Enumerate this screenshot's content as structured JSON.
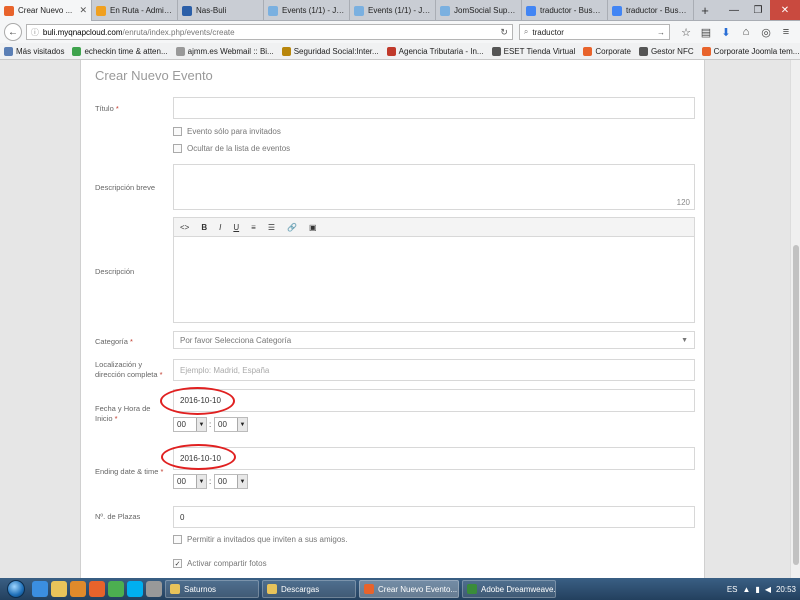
{
  "tabs": [
    {
      "label": "Crear Nuevo ...",
      "color": "#e8632b",
      "active": true
    },
    {
      "label": "En Ruta - Admin...",
      "color": "#f0a020",
      "active": false
    },
    {
      "label": "Nas-Buli",
      "color": "#2b5fa8",
      "active": false
    },
    {
      "label": "Events (1/1) - Jo...",
      "color": "#7ab0e0",
      "active": false
    },
    {
      "label": "Events (1/1) - Jo...",
      "color": "#7ab0e0",
      "active": false
    },
    {
      "label": "JomSocial Supp...",
      "color": "#7ab0e0",
      "active": false
    },
    {
      "label": "traductor - Busc...",
      "color": "#4285f4",
      "active": false
    },
    {
      "label": "traductor - Busc...",
      "color": "#4285f4",
      "active": false
    }
  ],
  "nav": {
    "url_host": "buli.myqnapcloud.com",
    "url_path": "/enruta/index.php/events/create",
    "search_text": "traductor"
  },
  "bookmarks": [
    {
      "label": "Más visitados",
      "color": "#5b7fb5"
    },
    {
      "label": "echeckin time & atten...",
      "color": "#3fa34d"
    },
    {
      "label": "ajmm.es Webmail :: Bi...",
      "color": "#999999"
    },
    {
      "label": "Seguridad Social:Inter...",
      "color": "#b8860b"
    },
    {
      "label": "Agencia Tributaria - In...",
      "color": "#c0392b"
    },
    {
      "label": "ESET Tienda Virtual",
      "color": "#555555"
    },
    {
      "label": "Corporate",
      "color": "#e8632b"
    },
    {
      "label": "Gestor NFC",
      "color": "#555555"
    },
    {
      "label": "Corporate Joomla tem...",
      "color": "#e8632b"
    }
  ],
  "form": {
    "title": "Crear Nuevo Evento",
    "titulo_label": "Título",
    "req": "*",
    "invite_only": "Evento sólo para invitados",
    "hide_list": "Ocultar de la lista de eventos",
    "short_desc_label": "Descripción breve",
    "counter": "120",
    "toolbar": [
      "<>",
      "B",
      "I",
      "U",
      "≡",
      "☰",
      "🔗",
      "▣"
    ],
    "desc_label": "Descripción",
    "category_label": "Categoría",
    "category_value": "Por favor Selecciona Categoría",
    "location_label": "Localización y dirección completa",
    "location_placeholder": "Ejemplo: Madrid, España",
    "start_label": "Fecha y Hora de Inicio",
    "start_date": "2016-10-10",
    "start_hour": "00",
    "start_min": "00",
    "end_label": "Ending date & time",
    "end_date": "2016-10-10",
    "end_hour": "00",
    "end_min": "00",
    "colon": ":",
    "seats_label": "Nº. de Plazas",
    "seats_value": "0",
    "allow_invite": "Permitir a invitados que inviten a sus amigos.",
    "share_photos": "Activar compartir fotos",
    "share_photos_checked": "✓"
  },
  "taskbar": {
    "tasks": [
      {
        "label": "Saturnos",
        "color": "#e8c35a",
        "active": false
      },
      {
        "label": "Descargas",
        "color": "#e8c35a",
        "active": false
      },
      {
        "label": "Crear Nuevo Evento...",
        "color": "#e8632b",
        "active": true
      },
      {
        "label": "Adobe Dreamweave...",
        "color": "#3a8c3a",
        "active": false
      }
    ],
    "lang": "ES",
    "time": "20:53"
  }
}
